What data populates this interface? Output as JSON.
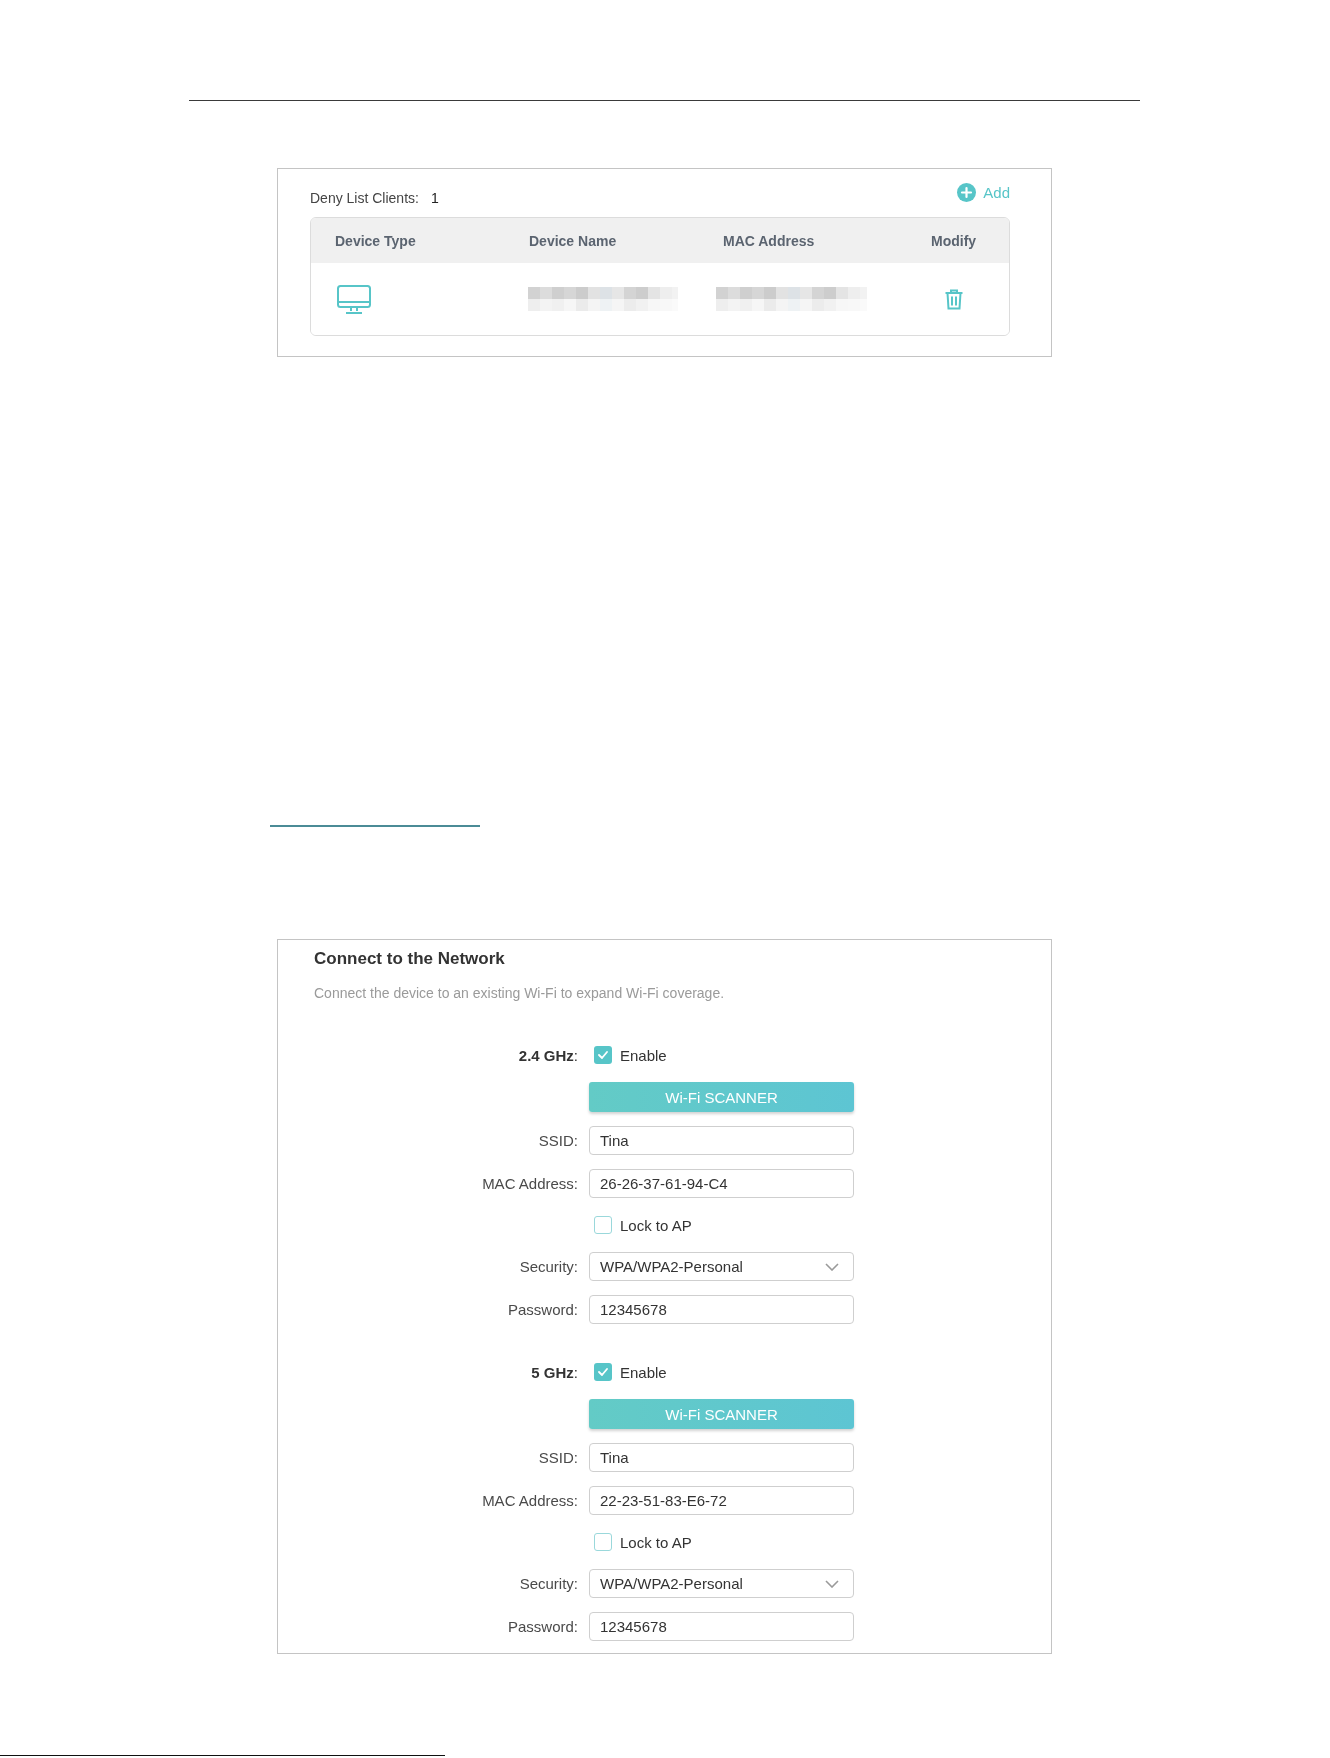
{
  "deny_list": {
    "label": "Deny List Clients:",
    "count": "1",
    "add_button": "Add",
    "columns": [
      "Device Type",
      "Device Name",
      "MAC Address",
      "Modify"
    ],
    "rows": [
      {
        "kind": "computer"
      }
    ]
  },
  "network": {
    "title": "Connect to the Network",
    "description": "Connect the device to an existing Wi-Fi to expand Wi-Fi coverage.",
    "sections": [
      {
        "band": "**2.4 GHz**:",
        "enable": {
          "label": "Enable",
          "checked": true
        },
        "scanner_button": "Wi-Fi SCANNER",
        "fields": [
          {
            "kind": "text",
            "label": "SSID:",
            "value": "Tina"
          },
          {
            "kind": "text",
            "label": "MAC Address:",
            "value": "26-26-37-61-94-C4"
          },
          {
            "kind": "checkbox",
            "label": "Lock to AP",
            "checked": false
          },
          {
            "kind": "select",
            "label": "Security:",
            "value": "WPA/WPA2-Personal"
          },
          {
            "kind": "text",
            "label": "Password:",
            "value": "12345678"
          }
        ]
      },
      {
        "band": "**5 GHz**:",
        "enable": {
          "label": "Enable",
          "checked": true
        },
        "scanner_button": "Wi-Fi SCANNER",
        "fields": [
          {
            "kind": "text",
            "label": "SSID:",
            "value": "Tina"
          },
          {
            "kind": "text",
            "label": "MAC Address:",
            "value": "22-23-51-83-E6-72"
          },
          {
            "kind": "checkbox",
            "label": "Lock to AP",
            "checked": false
          },
          {
            "kind": "select",
            "label": "Security:",
            "value": "WPA/WPA2-Personal"
          },
          {
            "kind": "text",
            "label": "Password:",
            "value": "12345678"
          }
        ]
      }
    ]
  }
}
